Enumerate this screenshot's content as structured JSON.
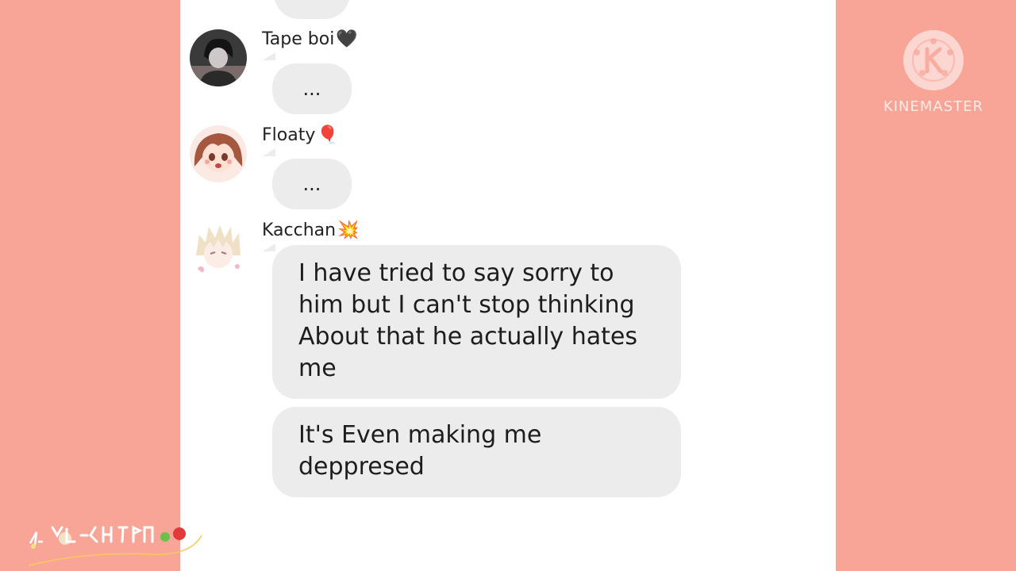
{
  "messages": [
    {
      "user": "Tape boi",
      "user_emoji": "🖤",
      "avatar": "dark-hair-avatar-icon",
      "bubbles": [
        "..."
      ]
    },
    {
      "user": "Floaty",
      "user_emoji": "🎈",
      "avatar": "brown-hair-avatar-icon",
      "bubbles": [
        "..."
      ]
    },
    {
      "user": "Kacchan",
      "user_emoji": "💥",
      "avatar": "blonde-hair-avatar-icon",
      "bubbles": [
        "I have tried to say sorry to him but I can't stop thinking About that he actually hates me",
        "It's Even making me deppresed"
      ]
    }
  ],
  "watermark": {
    "text": "KINEMASTER",
    "icon": "kinemaster-logo-icon"
  },
  "signature": {
    "text": "ᒪᓰᘜᑢᕼᗩᑎ",
    "icon": "handwritten-signature-icon"
  },
  "colors": {
    "background": "#f8a598",
    "bubble": "#ececec",
    "panel": "#ffffff"
  }
}
